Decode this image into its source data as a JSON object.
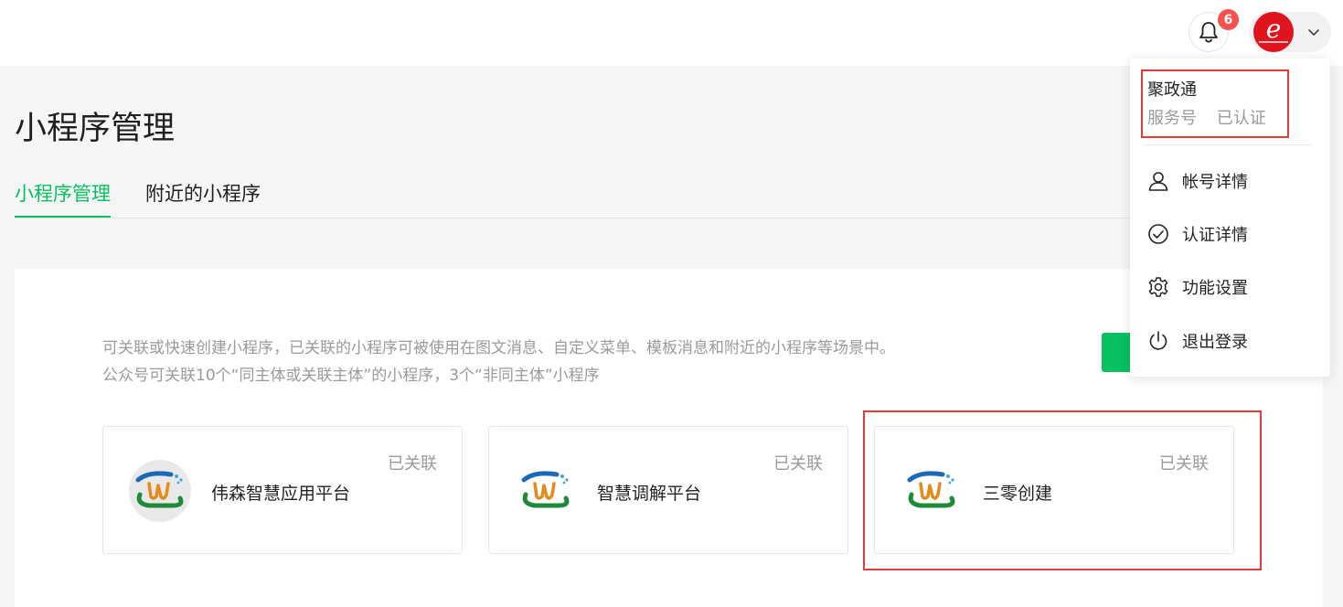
{
  "header": {
    "notification_count": "6"
  },
  "page": {
    "title": "小程序管理"
  },
  "tabs": [
    {
      "label": "小程序管理",
      "active": true
    },
    {
      "label": "附近的小程序",
      "active": false
    }
  ],
  "description": {
    "line1": "可关联或快速创建小程序，已关联的小程序可被使用在图文消息、自定义菜单、模板消息和附近的小程序等场景中。",
    "line2": "公众号可关联10个“同主体或关联主体”的小程序，3个“非同主体”小程序"
  },
  "cards": [
    {
      "name": "伟森智慧应用平台",
      "status": "已关联",
      "icon": "app-logo-icon"
    },
    {
      "name": "智慧调解平台",
      "status": "已关联",
      "icon": "app-logo-icon"
    },
    {
      "name": "三零创建",
      "status": "已关联",
      "icon": "app-logo-icon"
    }
  ],
  "account_menu": {
    "account_name": "聚政通",
    "account_type": "服务号",
    "verify_status": "已认证",
    "items": [
      {
        "label": "帐号详情",
        "icon": "user-icon"
      },
      {
        "label": "认证详情",
        "icon": "check-circle-icon"
      },
      {
        "label": "功能设置",
        "icon": "gear-icon"
      },
      {
        "label": "退出登录",
        "icon": "power-icon"
      }
    ]
  },
  "colors": {
    "accent": "#07c160",
    "badge": "#fa5151",
    "highlight": "#e03c3c",
    "avatar": "#e0141c"
  }
}
